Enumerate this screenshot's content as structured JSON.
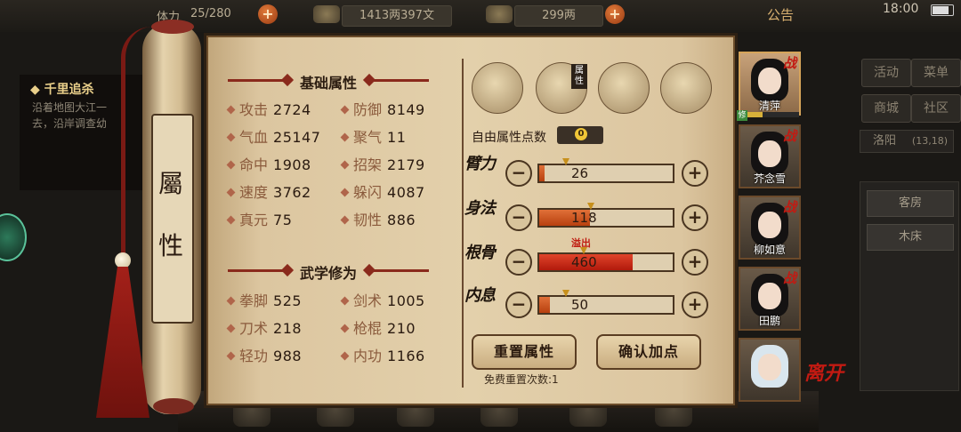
{
  "topbar": {
    "stamina": "25/280",
    "stamina_prefix": "体力",
    "money": "1413两397文",
    "gold": "299两",
    "notice": "公告",
    "clock": "18:00"
  },
  "quest": {
    "title": "千里追杀",
    "lines": [
      "沿着地图大江一",
      "去，沿岸调查幼"
    ]
  },
  "right_panel": {
    "buttons": [
      "活动",
      "菜单",
      "商城",
      "社区"
    ],
    "location_name": "洛阳",
    "location_coord": "(13,18)",
    "rooms": [
      "客房",
      "木床"
    ]
  },
  "scroll": {
    "title_char1": "屬",
    "title_char2": "性"
  },
  "basic": {
    "header": "基础属性",
    "stats": [
      {
        "name": "攻击",
        "value": "2724"
      },
      {
        "name": "防御",
        "value": "8149"
      },
      {
        "name": "气血",
        "value": "25147"
      },
      {
        "name": "聚气",
        "value": "11"
      },
      {
        "name": "命中",
        "value": "1908"
      },
      {
        "name": "招架",
        "value": "2179"
      },
      {
        "name": "速度",
        "value": "3762"
      },
      {
        "name": "躲闪",
        "value": "4087"
      },
      {
        "name": "真元",
        "value": "75"
      },
      {
        "name": "韧性",
        "value": "886"
      }
    ]
  },
  "martial": {
    "header": "武学修为",
    "stats": [
      {
        "name": "拳脚",
        "value": "525"
      },
      {
        "name": "剑术",
        "value": "1005"
      },
      {
        "name": "刀术",
        "value": "218"
      },
      {
        "name": "枪棍",
        "value": "210"
      },
      {
        "name": "轻功",
        "value": "988"
      },
      {
        "name": "内功",
        "value": "1166"
      }
    ]
  },
  "tabs": {
    "attr_label": "属性",
    "icons": [
      "hat-character-icon",
      "scroll-attribute-icon",
      "bagua-icon",
      "body-meridian-icon"
    ]
  },
  "free_points": {
    "label": "自由属性点数",
    "value": "0"
  },
  "attributes": [
    {
      "name": "臂力",
      "value": "26",
      "level": 0.04,
      "overflow": false
    },
    {
      "name": "身法",
      "value": "118",
      "level": 0.38,
      "overflow": false
    },
    {
      "name": "根骨",
      "value": "460",
      "level": 0.7,
      "overflow": true
    },
    {
      "name": "内息",
      "value": "50",
      "level": 0.08,
      "overflow": false
    }
  ],
  "overflow_label": "溢出",
  "buttons": {
    "reset": "重置属性",
    "confirm": "确认加点",
    "reset_note": "免费重置次数:1"
  },
  "characters": [
    {
      "name": "清萍",
      "tag": "战",
      "active": true,
      "hair": "dark"
    },
    {
      "name": "芥念雪",
      "tag": "战",
      "active": false,
      "hair": "dark"
    },
    {
      "name": "柳如意",
      "tag": "战",
      "active": false,
      "hair": "dark"
    },
    {
      "name": "田鹏",
      "tag": "战",
      "active": false,
      "hair": "dark"
    },
    {
      "name": "",
      "tag": "",
      "active": false,
      "hair": "white"
    }
  ],
  "party_badge": "修",
  "party_exp_level": 0.3,
  "leave_label": "离开",
  "colors": {
    "accent_red": "#c21a12",
    "fill_orange": "#d4581f",
    "overflow_red": "#c8200f",
    "parchment": "#e3d0ab"
  }
}
